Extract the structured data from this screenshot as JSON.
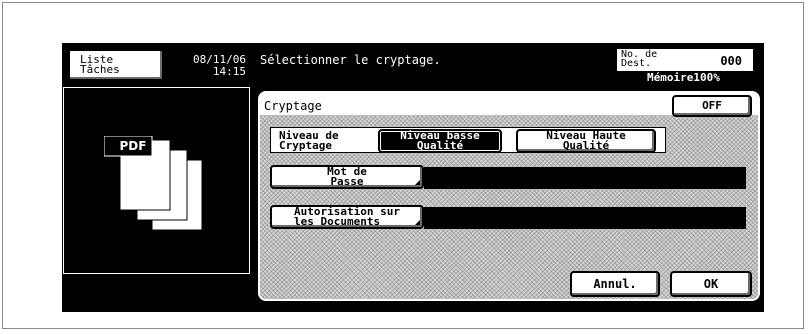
{
  "header": {
    "job_list_label": "Liste\nTâches",
    "date": "08/11/06",
    "time": "14:15",
    "message": "Sélectionner le cryptage.",
    "dest_label": "No. de\nDest.",
    "dest_count": "000",
    "memory": "Mémoire100%"
  },
  "preview": {
    "file_type": "PDF",
    "icon": "pdf-stack-icon"
  },
  "panel": {
    "title": "Cryptage",
    "off_label": "OFF",
    "level_label": "Niveau de\nCryptage",
    "low_label": "Niveau basse\nQualité",
    "high_label": "Niveau Haute\nQualité",
    "password_label": "Mot de\nPasse",
    "permission_label": "Autorisation sur\nles Documents",
    "password_value": "",
    "permission_value": "",
    "cancel_label": "Annul.",
    "ok_label": "OK",
    "selected_level": "low"
  }
}
